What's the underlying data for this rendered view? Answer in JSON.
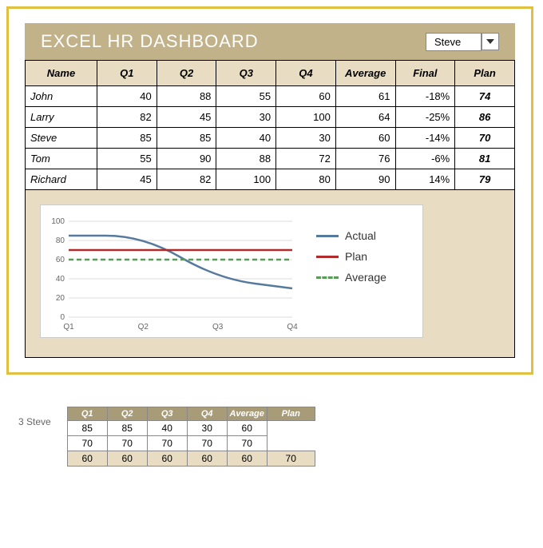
{
  "header": {
    "title": "EXCEL HR DASHBOARD",
    "selector_value": "Steve"
  },
  "table": {
    "headers": [
      "Name",
      "Q1",
      "Q2",
      "Q3",
      "Q4",
      "Average",
      "Final",
      "Plan"
    ],
    "rows": [
      {
        "name": "John",
        "q1": "40",
        "q2": "88",
        "q3": "55",
        "q4": "60",
        "avg": "61",
        "final": "-18%",
        "plan": "74"
      },
      {
        "name": "Larry",
        "q1": "82",
        "q2": "45",
        "q3": "30",
        "q4": "100",
        "avg": "64",
        "final": "-25%",
        "plan": "86"
      },
      {
        "name": "Steve",
        "q1": "85",
        "q2": "85",
        "q3": "40",
        "q4": "30",
        "avg": "60",
        "final": "-14%",
        "plan": "70"
      },
      {
        "name": "Tom",
        "q1": "55",
        "q2": "90",
        "q3": "88",
        "q4": "72",
        "avg": "76",
        "final": "-6%",
        "plan": "81"
      },
      {
        "name": "Richard",
        "q1": "45",
        "q2": "82",
        "q3": "100",
        "q4": "80",
        "avg": "90",
        "final": "14%",
        "plan": "79"
      }
    ]
  },
  "chart_data": {
    "type": "line",
    "categories": [
      "Q1",
      "Q2",
      "Q3",
      "Q4"
    ],
    "series": [
      {
        "name": "Actual",
        "values": [
          85,
          85,
          40,
          30
        ],
        "color": "#557a9e",
        "style": "solid"
      },
      {
        "name": "Plan",
        "values": [
          70,
          70,
          70,
          70
        ],
        "color": "#b02b2b",
        "style": "solid"
      },
      {
        "name": "Average",
        "values": [
          60,
          60,
          60,
          60
        ],
        "color": "#5a9b5a",
        "style": "dashed"
      }
    ],
    "ylim": [
      0,
      100
    ],
    "yticks": [
      0,
      20,
      40,
      60,
      80,
      100
    ],
    "xlabel": "",
    "ylabel": "",
    "title": ""
  },
  "legend": {
    "actual": "Actual",
    "plan": "Plan",
    "average": "Average"
  },
  "bottom": {
    "label": "3 Steve",
    "headers": [
      "Q1",
      "Q2",
      "Q3",
      "Q4",
      "Average",
      "Plan"
    ],
    "rows": [
      {
        "cells": [
          "85",
          "85",
          "40",
          "30",
          "60",
          ""
        ],
        "hl": false
      },
      {
        "cells": [
          "70",
          "70",
          "70",
          "70",
          "70",
          ""
        ],
        "hl": false
      },
      {
        "cells": [
          "60",
          "60",
          "60",
          "60",
          "60",
          "70"
        ],
        "hl": true
      }
    ]
  }
}
